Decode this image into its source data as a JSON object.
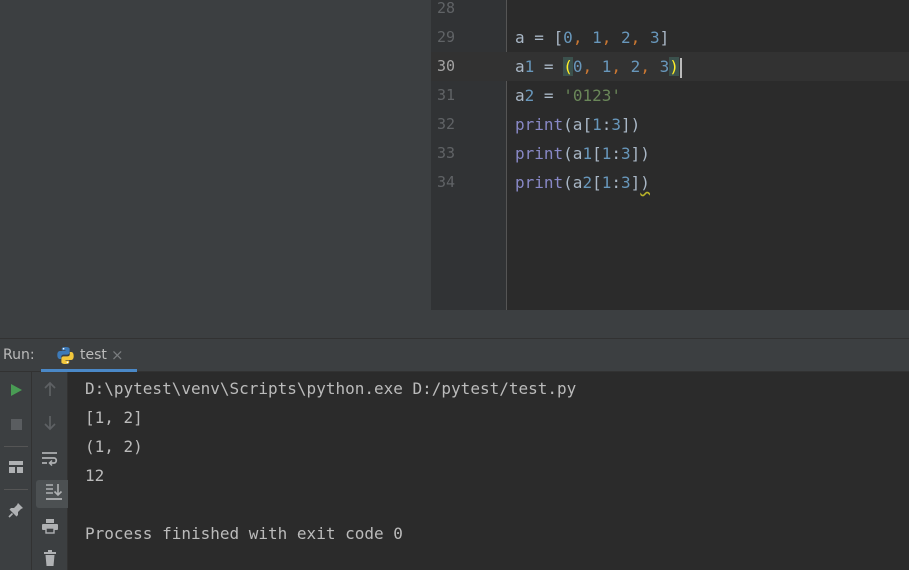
{
  "editor": {
    "lines": [
      {
        "number": "28",
        "text": ""
      },
      {
        "number": "29",
        "text": "a = [0, 1, 2, 3]"
      },
      {
        "number": "30",
        "text": "a1 = (0, 1, 2, 3)"
      },
      {
        "number": "31",
        "text": "a2 = '0123'"
      },
      {
        "number": "32",
        "text": "print(a[1:3])"
      },
      {
        "number": "33",
        "text": "print(a1[1:3])"
      },
      {
        "number": "34",
        "text": "print(a2[1:3])"
      }
    ],
    "current_line": "30"
  },
  "run_window": {
    "label": "Run:",
    "tab_name": "test",
    "tab_close": "×",
    "tab_icon": "python-icon"
  },
  "toolbar": {
    "left_icons": [
      "run-icon",
      "stop-icon",
      "layout-icon",
      "pin-icon"
    ],
    "right_icons": [
      "up-arrow-icon",
      "down-arrow-icon",
      "soft-wrap-icon",
      "scroll-to-end-icon",
      "print-icon",
      "trash-icon"
    ]
  },
  "console": {
    "lines": [
      "D:\\pytest\\venv\\Scripts\\python.exe D:/pytest/test.py",
      "[1, 2]",
      "(1, 2)",
      "12",
      "",
      "Process finished with exit code 0"
    ]
  },
  "colors": {
    "background": "#2b2b2b",
    "panel": "#3c3f41",
    "number": "#6897bb",
    "keyword_comma": "#cc7832",
    "string": "#6a8759",
    "builtin": "#8888c6",
    "run_green": "#499c54",
    "tab_underline": "#4a88c7"
  }
}
